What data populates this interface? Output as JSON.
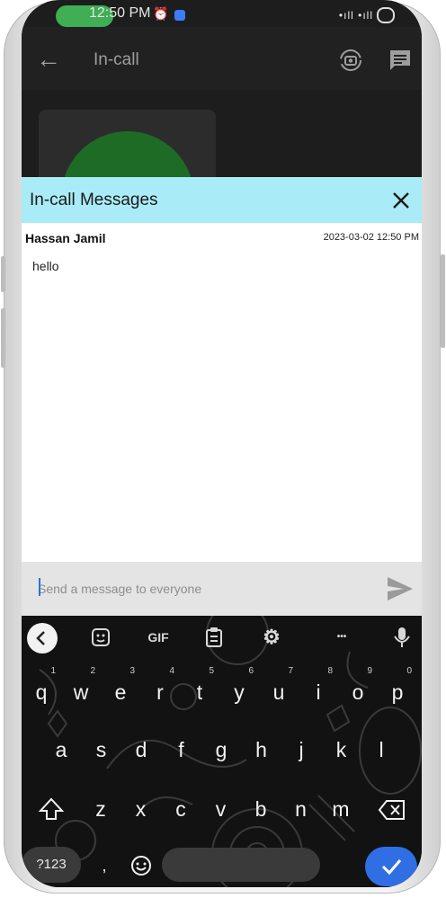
{
  "status_bar": {
    "time": "12:50 PM",
    "signal": "•ıll •ıll"
  },
  "app_bar": {
    "back_icon": "arrow-back-icon",
    "title": "In-call"
  },
  "panel": {
    "title": "In-call Messages",
    "message": {
      "sender": "Hassan Jamil",
      "timestamp": "2023-03-02 12:50 PM",
      "text": "hello"
    },
    "composer_placeholder": "Send a message to everyone"
  },
  "keyboard": {
    "toolbar": {
      "gif_label": "GIF",
      "more_label": "•••"
    },
    "row1": [
      {
        "key": "q",
        "hint": "1"
      },
      {
        "key": "w",
        "hint": "2"
      },
      {
        "key": "e",
        "hint": "3"
      },
      {
        "key": "r",
        "hint": "4"
      },
      {
        "key": "t",
        "hint": "5"
      },
      {
        "key": "y",
        "hint": "6"
      },
      {
        "key": "u",
        "hint": "7"
      },
      {
        "key": "i",
        "hint": "8"
      },
      {
        "key": "o",
        "hint": "9"
      },
      {
        "key": "p",
        "hint": "0"
      }
    ],
    "row2": [
      "a",
      "s",
      "d",
      "f",
      "g",
      "h",
      "j",
      "k",
      "l"
    ],
    "row3": [
      "z",
      "x",
      "c",
      "v",
      "b",
      "n",
      "m"
    ],
    "symbols_label": "?123",
    "comma_label": ","
  },
  "colors": {
    "panel_header": "#a9ebf6",
    "enter_key": "#2f6fe3",
    "avatar": "#1e6b26"
  }
}
